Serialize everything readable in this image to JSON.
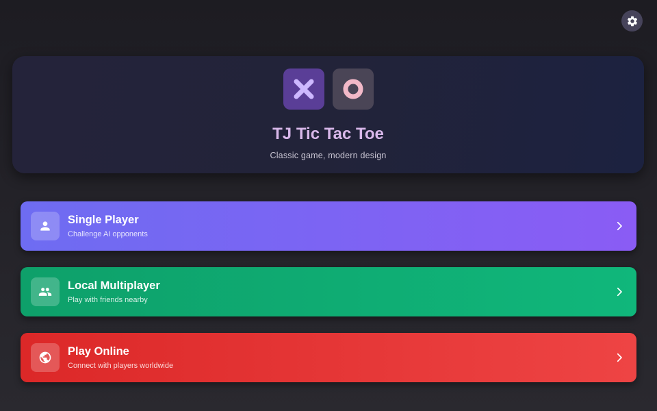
{
  "hero": {
    "title": "TJ Tic Tac Toe",
    "subtitle": "Classic game, modern design"
  },
  "modes": [
    {
      "title": "Single Player",
      "subtitle": "Challenge AI opponents",
      "icon": "person-icon",
      "colors": [
        "#6e6cf2",
        "#8a5cf4"
      ]
    },
    {
      "title": "Local Multiplayer",
      "subtitle": "Play with friends nearby",
      "icon": "group-icon",
      "colors": [
        "#0ea06a",
        "#10b77b"
      ]
    },
    {
      "title": "Play Online",
      "subtitle": "Connect with players worldwide",
      "icon": "globe-icon",
      "colors": [
        "#dc2828",
        "#ee4444"
      ]
    }
  ],
  "icons": {
    "settings": "gear-icon",
    "x_tile": "x-icon",
    "o_tile": "o-icon"
  },
  "colors": {
    "x_tile": "#5a3e97",
    "x_mark": "#cdb8ff",
    "o_tile": "#4a4556",
    "o_mark": "#f2b9c8",
    "title": "#d9b8ea"
  }
}
